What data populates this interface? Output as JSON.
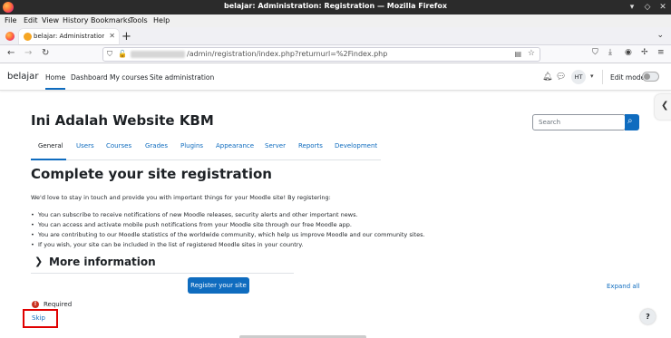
{
  "window": {
    "title": "belajar: Administration: Registration — Mozilla Firefox",
    "controls": [
      "▾",
      "◇",
      "✕"
    ]
  },
  "menubar": [
    "File",
    "Edit",
    "View",
    "History",
    "Bookmarks",
    "Tools",
    "Help"
  ],
  "tab": {
    "title": "belajar: Administration: Re",
    "close": "✕",
    "new_tab": "+"
  },
  "urlbar": {
    "path": "/admin/registration/index.php?returnurl=%2Findex.php"
  },
  "header": {
    "brand": "belajar",
    "nav": [
      "Home",
      "Dashboard",
      "My courses",
      "Site administration"
    ],
    "avatar_initials": "HT",
    "edit_mode_label": "Edit mode"
  },
  "page": {
    "site_name": "Ini Adalah Website KBM",
    "search_placeholder": "Search",
    "secondary_nav": [
      "General",
      "Users",
      "Courses",
      "Grades",
      "Plugins",
      "Appearance",
      "Server",
      "Reports",
      "Development"
    ],
    "heading": "Complete your site registration",
    "intro": "We'd love to stay in touch and provide you with important things for your Moodle site! By registering:",
    "bullets": [
      "You can subscribe to receive notifications of new Moodle releases, security alerts and other important news.",
      "You can access and activate mobile push notifications from your Moodle site through our free Moodle app.",
      "You are contributing to our Moodle statistics of the worldwide community, which help us improve Moodle and our community sites.",
      "If you wish, your site can be included in the list of registered Moodle sites in your country."
    ],
    "more_info": "More information",
    "expand_all": "Expand all",
    "register_button": "Register your site",
    "required_label": "Required",
    "skip_link": "Skip",
    "help_button": "?"
  },
  "colors": {
    "primary": "#0f6cbf",
    "required": "#ca3120",
    "highlight_box": "#e00000"
  }
}
